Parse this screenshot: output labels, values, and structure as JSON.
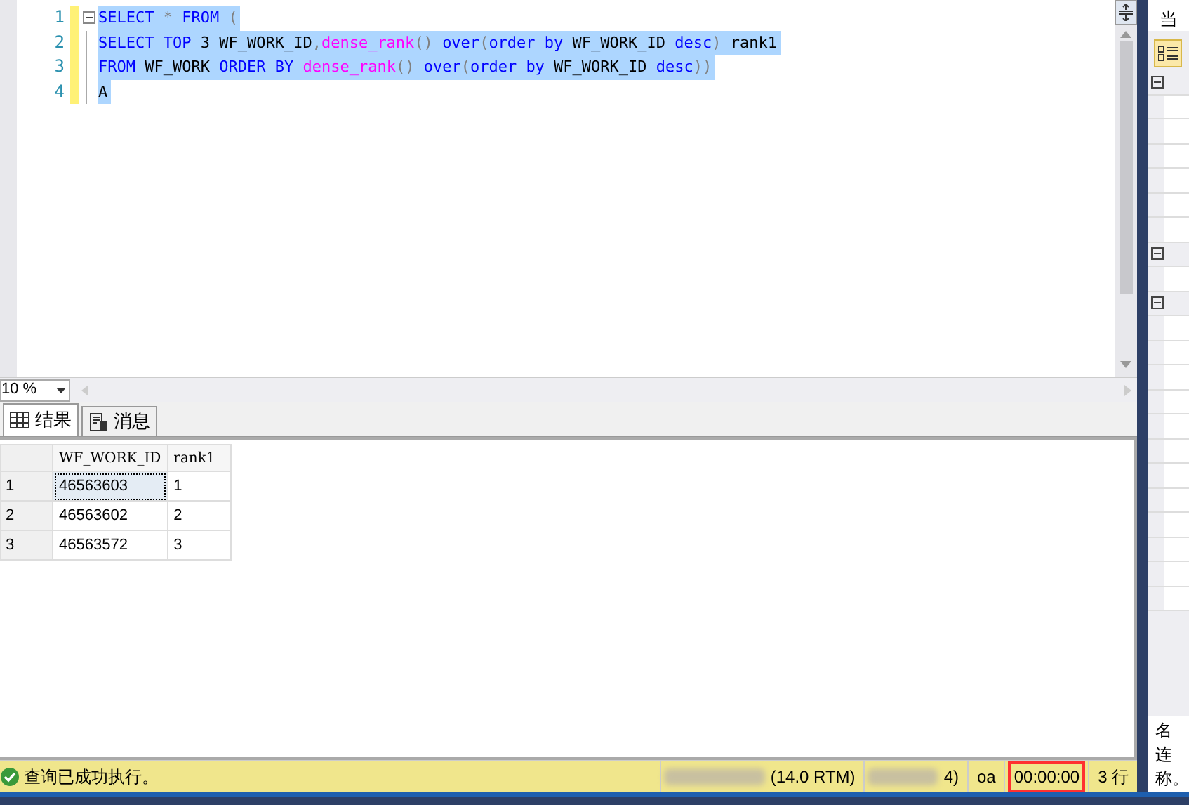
{
  "editor": {
    "lines": [
      {
        "number": "1",
        "fold": true,
        "tokens": [
          {
            "kind": "keyword",
            "text": "SELECT"
          },
          {
            "kind": "operator",
            "text": " * "
          },
          {
            "kind": "keyword",
            "text": "FROM"
          },
          {
            "kind": "operator",
            "text": " ("
          }
        ]
      },
      {
        "number": "2",
        "fold": false,
        "tokens": [
          {
            "kind": "keyword",
            "text": "SELECT TOP"
          },
          {
            "kind": "plain",
            "text": " 3 WF_WORK_ID"
          },
          {
            "kind": "operator",
            "text": ","
          },
          {
            "kind": "function",
            "text": "dense_rank"
          },
          {
            "kind": "operator",
            "text": "() "
          },
          {
            "kind": "keyword",
            "text": "over"
          },
          {
            "kind": "operator",
            "text": "("
          },
          {
            "kind": "keyword",
            "text": "order by"
          },
          {
            "kind": "plain",
            "text": " WF_WORK_ID "
          },
          {
            "kind": "keyword",
            "text": "desc"
          },
          {
            "kind": "operator",
            "text": ")"
          },
          {
            "kind": "plain",
            "text": " rank1"
          }
        ]
      },
      {
        "number": "3",
        "fold": false,
        "tokens": [
          {
            "kind": "keyword",
            "text": "FROM"
          },
          {
            "kind": "plain",
            "text": " WF_WORK "
          },
          {
            "kind": "keyword",
            "text": "ORDER BY "
          },
          {
            "kind": "function",
            "text": "dense_rank"
          },
          {
            "kind": "operator",
            "text": "() "
          },
          {
            "kind": "keyword",
            "text": "over"
          },
          {
            "kind": "operator",
            "text": "("
          },
          {
            "kind": "keyword",
            "text": "order by"
          },
          {
            "kind": "plain",
            "text": " WF_WORK_ID "
          },
          {
            "kind": "keyword",
            "text": "desc"
          },
          {
            "kind": "operator",
            "text": "))"
          }
        ]
      },
      {
        "number": "4",
        "fold": false,
        "tokens": [
          {
            "kind": "plain",
            "text": "A"
          }
        ]
      }
    ],
    "zoom": "10 %"
  },
  "result_tabs": [
    {
      "label": "结果",
      "selected": true
    },
    {
      "label": "消息",
      "selected": false
    }
  ],
  "grid": {
    "columns": [
      "WF_WORK_ID",
      "rank1"
    ],
    "rows": [
      {
        "header": "1",
        "cells": [
          "46563603",
          "1"
        ],
        "focused": true
      },
      {
        "header": "2",
        "cells": [
          "46563602",
          "2"
        ],
        "focused": false
      },
      {
        "header": "3",
        "cells": [
          "46563572",
          "3"
        ],
        "focused": false
      }
    ]
  },
  "status_bar": {
    "message": "查询已成功执行。",
    "items": [
      {
        "text": "(14.0 RTM)",
        "blurred": true,
        "highlighted": false
      },
      {
        "text": "4)",
        "blurred": true,
        "highlighted": false
      },
      {
        "text": "oa",
        "blurred": false,
        "highlighted": false
      },
      {
        "text": "00:00:00",
        "blurred": false,
        "highlighted": true
      },
      {
        "text": "3 行",
        "blurred": false,
        "highlighted": false
      }
    ]
  },
  "properties_panel": {
    "title": "当",
    "description": [
      "名",
      "连",
      "称。"
    ]
  }
}
